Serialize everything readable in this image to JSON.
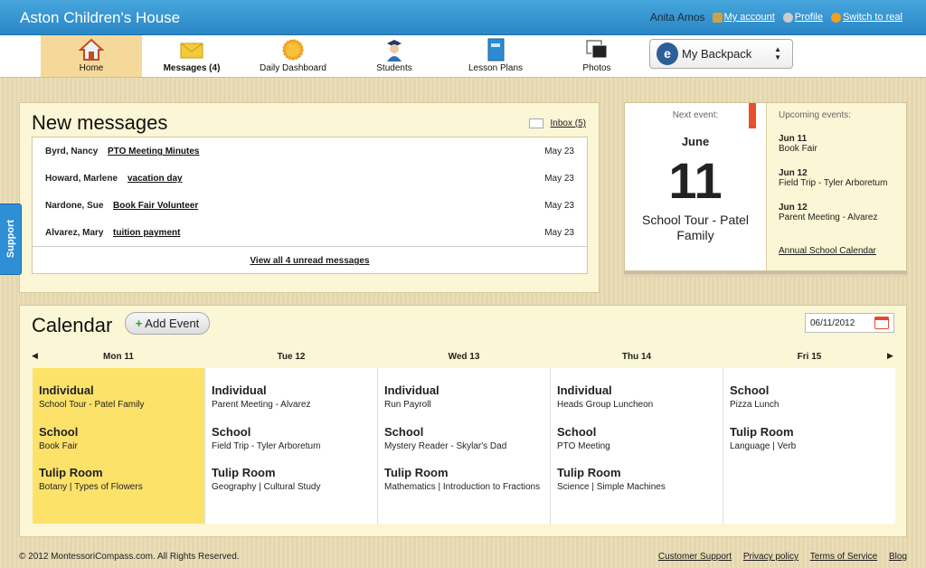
{
  "header": {
    "brand": "Aston Children's House",
    "user_name": "Anita Amos",
    "my_account": "My account",
    "profile": "Profile",
    "switch": "Switch to real"
  },
  "nav": {
    "items": [
      {
        "label": "Home",
        "icon": "home-icon"
      },
      {
        "label": "Messages (4)",
        "icon": "envelope-icon"
      },
      {
        "label": "Daily Dashboard",
        "icon": "sun-icon"
      },
      {
        "label": "Students",
        "icon": "graduate-icon"
      },
      {
        "label": "Lesson Plans",
        "icon": "book-icon"
      },
      {
        "label": "Photos",
        "icon": "photos-icon"
      }
    ],
    "backpack": "My Backpack"
  },
  "messages": {
    "title": "New messages",
    "inbox": "Inbox (5)",
    "rows": [
      {
        "from": "Byrd, Nancy",
        "subject": "PTO Meeting Minutes",
        "date": "May 23"
      },
      {
        "from": "Howard, Marlene",
        "subject": "vacation day",
        "date": "May 23"
      },
      {
        "from": "Nardone, Sue",
        "subject": "Book Fair Volunteer",
        "date": "May 23"
      },
      {
        "from": "Alvarez, Mary",
        "subject": "tuition payment",
        "date": "May 23"
      }
    ],
    "view_all": "View all 4 unread messages"
  },
  "events": {
    "next_label": "Next event:",
    "month": "June",
    "day": "11",
    "title": "School Tour - Patel Family",
    "upcoming_label": "Upcoming events:",
    "upcoming": [
      {
        "date": "Jun 11",
        "name": "Book Fair"
      },
      {
        "date": "Jun 12",
        "name": "Field Trip - Tyler Arboretum"
      },
      {
        "date": "Jun 12",
        "name": "Parent Meeting - Alvarez"
      }
    ],
    "annual": "Annual School Calendar"
  },
  "support": "Support",
  "calendar": {
    "title": "Calendar",
    "add_event": "Add Event",
    "date": "06/11/2012",
    "days": [
      {
        "label": "Mon 11",
        "events": [
          {
            "cat": "Individual",
            "desc": "School Tour - Patel Family"
          },
          {
            "cat": "School",
            "desc": "Book Fair"
          },
          {
            "cat": "Tulip Room",
            "desc": "Botany | Types of Flowers"
          }
        ]
      },
      {
        "label": "Tue 12",
        "events": [
          {
            "cat": "Individual",
            "desc": "Parent Meeting - Alvarez"
          },
          {
            "cat": "School",
            "desc": "Field Trip - Tyler Arboretum"
          },
          {
            "cat": "Tulip Room",
            "desc": "Geography | Cultural Study"
          }
        ]
      },
      {
        "label": "Wed 13",
        "events": [
          {
            "cat": "Individual",
            "desc": "Run Payroll"
          },
          {
            "cat": "School",
            "desc": "Mystery Reader - Skylar's Dad"
          },
          {
            "cat": "Tulip Room",
            "desc": "Mathematics | Introduction to Fractions"
          }
        ]
      },
      {
        "label": "Thu 14",
        "events": [
          {
            "cat": "Individual",
            "desc": "Heads Group Luncheon"
          },
          {
            "cat": "School",
            "desc": "PTO Meeting"
          },
          {
            "cat": "Tulip Room",
            "desc": "Science | Simple Machines"
          }
        ]
      },
      {
        "label": "Fri 15",
        "events": [
          {
            "cat": "School",
            "desc": "Pizza Lunch"
          },
          {
            "cat": "Tulip Room",
            "desc": "Language | Verb"
          }
        ]
      }
    ]
  },
  "footer": {
    "copyright": "© 2012 MontessoriCompass.com. All Rights Reserved.",
    "links": [
      "Customer Support",
      "Privacy policy",
      "Terms of Service",
      "Blog"
    ]
  },
  "colors": {
    "header": "#2a86c6",
    "today": "#fde26a",
    "active_nav": "#f5d99a"
  }
}
